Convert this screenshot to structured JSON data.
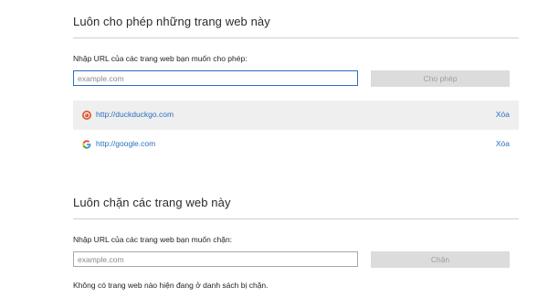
{
  "allow": {
    "title": "Luôn cho phép những trang web này",
    "prompt": "Nhập URL của các trang web bạn muốn cho phép:",
    "input_placeholder": "example.com",
    "button_label": "Cho phép",
    "sites": [
      {
        "url": "http://duckduckgo.com",
        "icon": "duckduckgo-icon",
        "remove_label": "Xóa"
      },
      {
        "url": "http://google.com",
        "icon": "google-icon",
        "remove_label": "Xóa"
      }
    ]
  },
  "block": {
    "title": "Luôn chặn các trang web này",
    "prompt": "Nhập URL của các trang web bạn muốn chặn:",
    "input_placeholder": "example.com",
    "button_label": "Chặn",
    "empty_message": "Không có trang web nào hiện đang ở danh sách bị chặn."
  },
  "colors": {
    "link": "#2a6fbf",
    "focused_border": "#2a6fbf",
    "disabled_button": "#dcdcdc"
  }
}
